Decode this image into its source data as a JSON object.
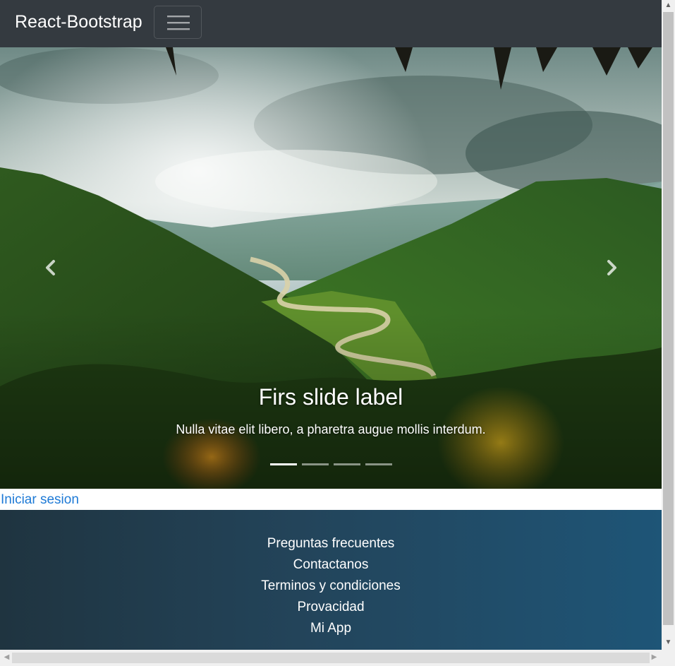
{
  "navbar": {
    "brand": "React-Bootstrap",
    "toggler_icon": "hamburger-icon"
  },
  "carousel": {
    "slide_title": "Firs slide label",
    "slide_description": "Nulla vitae elit libero, a pharetra augue mollis interdum.",
    "prev_icon": "chevron-left-icon",
    "next_icon": "chevron-right-icon",
    "slide_count": 4,
    "active_slide": 1,
    "image": "mountain-valley-river-photo"
  },
  "login": {
    "link_text": "Iniciar sesion"
  },
  "footer": {
    "links": [
      "Preguntas frecuentes",
      "Contactanos",
      "Terminos y condiciones",
      "Provacidad",
      "Mi App"
    ]
  },
  "colors": {
    "navbar_bg": "#343a40",
    "link": "#1e7ad6",
    "footer_start": "#1f3440",
    "footer_end": "#1e5577"
  }
}
